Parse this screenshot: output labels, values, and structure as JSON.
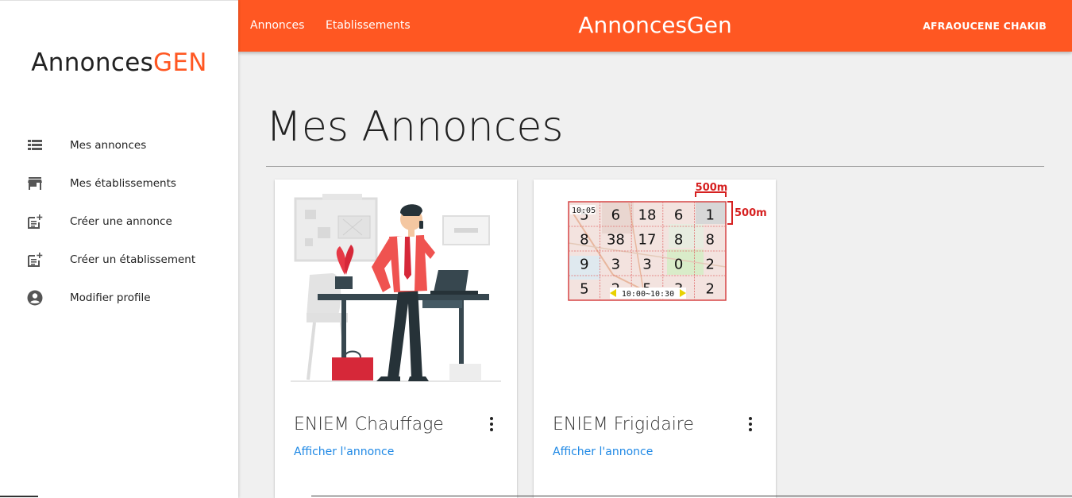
{
  "sidebar": {
    "brand_prefix": "Annonces",
    "brand_suffix": "GEN",
    "items": [
      {
        "label": "Mes annonces",
        "icon": "list-icon"
      },
      {
        "label": "Mes établissements",
        "icon": "store-icon"
      },
      {
        "label": "Créer une annonce",
        "icon": "post-add-icon"
      },
      {
        "label": "Créer un établissement",
        "icon": "post-add-icon"
      },
      {
        "label": "Modifier profile",
        "icon": "account-circle-icon"
      }
    ]
  },
  "topbar": {
    "links": [
      "Annonces",
      "Etablissements"
    ],
    "title": "AnnoncesGen",
    "user": "AFRAOUCENE CHAKIB"
  },
  "main": {
    "title": "Mes Annonces",
    "cards": [
      {
        "title": "ENIEM Chauffage",
        "action": "Afficher l'annonce",
        "image": "office-worker-illustration"
      },
      {
        "title": "ENIEM Frigidaire",
        "action": "Afficher l'annonce",
        "image": "grid-map",
        "map": {
          "scale_top": "500m",
          "scale_right": "500m",
          "time_top": "10:05",
          "time_range": "10:00~10:30",
          "grid": [
            [
              "5",
              "6",
              "18",
              "6",
              "1"
            ],
            [
              "8",
              "38",
              "17",
              "8",
              "8"
            ],
            [
              "9",
              "3",
              "3",
              "0",
              "2"
            ],
            [
              "5",
              "2",
              "5",
              "3",
              "2"
            ]
          ]
        }
      }
    ]
  },
  "colors": {
    "accent": "#ff5722",
    "link": "#1e88e5"
  }
}
